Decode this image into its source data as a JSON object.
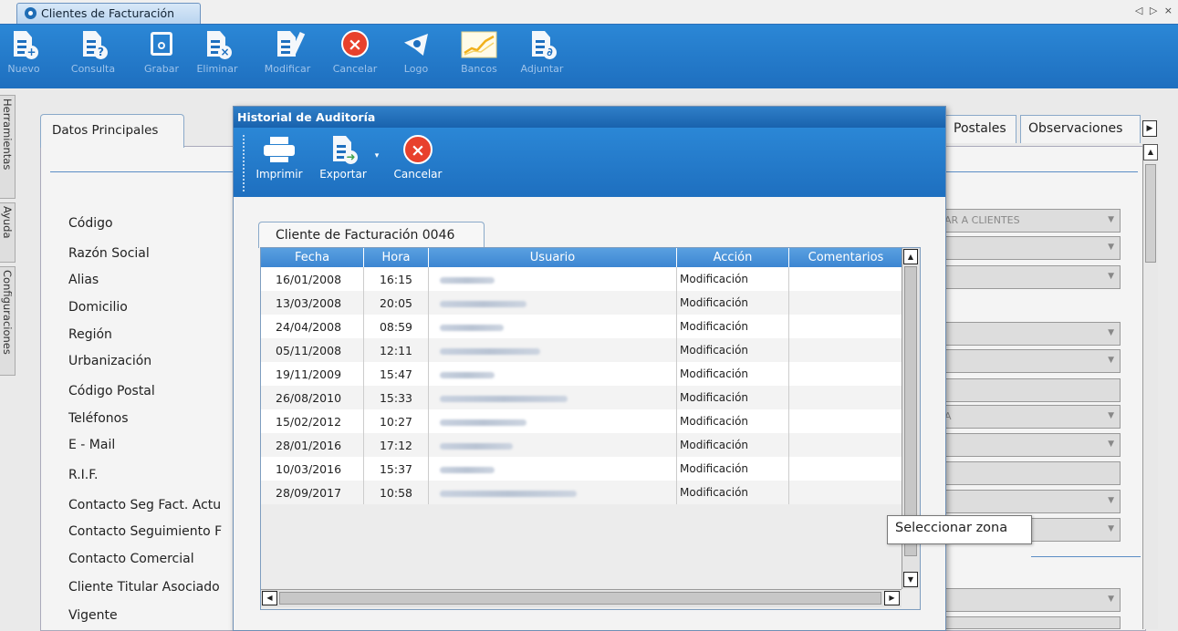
{
  "window": {
    "tab_title": "Clientes de Facturación",
    "nav_arrows": "◁ ▷ ×"
  },
  "toolbar": {
    "buttons": [
      {
        "label": "Nuevo",
        "icon": "new-document-icon",
        "active": false
      },
      {
        "label": "Consulta",
        "icon": "query-document-icon",
        "active": false
      },
      {
        "label": "Grabar",
        "icon": "save-icon",
        "active": false
      },
      {
        "label": "Eliminar",
        "icon": "delete-document-icon",
        "active": false
      },
      {
        "label": "Modificar",
        "icon": "edit-document-icon",
        "active": false
      },
      {
        "label": "Cancelar",
        "icon": "cancel-icon",
        "active": true
      },
      {
        "label": "Logo",
        "icon": "logo-icon",
        "active": false
      },
      {
        "label": "Bancos",
        "icon": "chart-icon",
        "active": true
      },
      {
        "label": "Adjuntar",
        "icon": "attach-document-icon",
        "active": false
      }
    ]
  },
  "side_tabs": [
    "Herramientas",
    "Ayuda",
    "Configuraciones"
  ],
  "form": {
    "main_tab": "Datos Principales",
    "right_tabs": [
      "Postales",
      "Observaciones"
    ],
    "labels": [
      "Código",
      "Razón Social",
      "Alias",
      "Domicilio",
      "Región",
      "Urbanización",
      "Código Postal",
      "Teléfonos",
      "E - Mail",
      "R.I.F.",
      "Contacto Seg Fact. Actu",
      "Contacto Seguimiento F",
      "Contacto Comercial",
      "Cliente Titular Asociado",
      "Vigente"
    ],
    "right_field_texts": [
      "AR A CLIENTES",
      "A"
    ]
  },
  "dialog": {
    "title": "Historial de Auditoría",
    "tools": [
      {
        "label": "Imprimir",
        "icon": "printer-icon"
      },
      {
        "label": "Exportar",
        "icon": "export-document-icon"
      },
      {
        "label": "Cancelar",
        "icon": "cancel-icon"
      }
    ],
    "tab": "Cliente de Facturación 0046",
    "columns": [
      "Fecha",
      "Hora",
      "Usuario",
      "Acción",
      "Comentarios"
    ],
    "rows": [
      {
        "fecha": "16/01/2008",
        "hora": "16:15",
        "accion": "Modificación",
        "comentarios": ""
      },
      {
        "fecha": "13/03/2008",
        "hora": "20:05",
        "accion": "Modificación",
        "comentarios": ""
      },
      {
        "fecha": "24/04/2008",
        "hora": "08:59",
        "accion": "Modificación",
        "comentarios": ""
      },
      {
        "fecha": "05/11/2008",
        "hora": "12:11",
        "accion": "Modificación",
        "comentarios": ""
      },
      {
        "fecha": "19/11/2009",
        "hora": "15:47",
        "accion": "Modificación",
        "comentarios": ""
      },
      {
        "fecha": "26/08/2010",
        "hora": "15:33",
        "accion": "Modificación",
        "comentarios": ""
      },
      {
        "fecha": "15/02/2012",
        "hora": "10:27",
        "accion": "Modificación",
        "comentarios": ""
      },
      {
        "fecha": "28/01/2016",
        "hora": "17:12",
        "accion": "Modificación",
        "comentarios": ""
      },
      {
        "fecha": "10/03/2016",
        "hora": "15:37",
        "accion": "Modificación",
        "comentarios": ""
      },
      {
        "fecha": "28/09/2017",
        "hora": "10:58",
        "accion": "Modificación",
        "comentarios": ""
      }
    ]
  },
  "tooltip": "Seleccionar zona",
  "colors": {
    "toolbar_blue": "#1e6fbf",
    "grid_header": "#3c86d2",
    "cancel_red": "#e8412c"
  }
}
